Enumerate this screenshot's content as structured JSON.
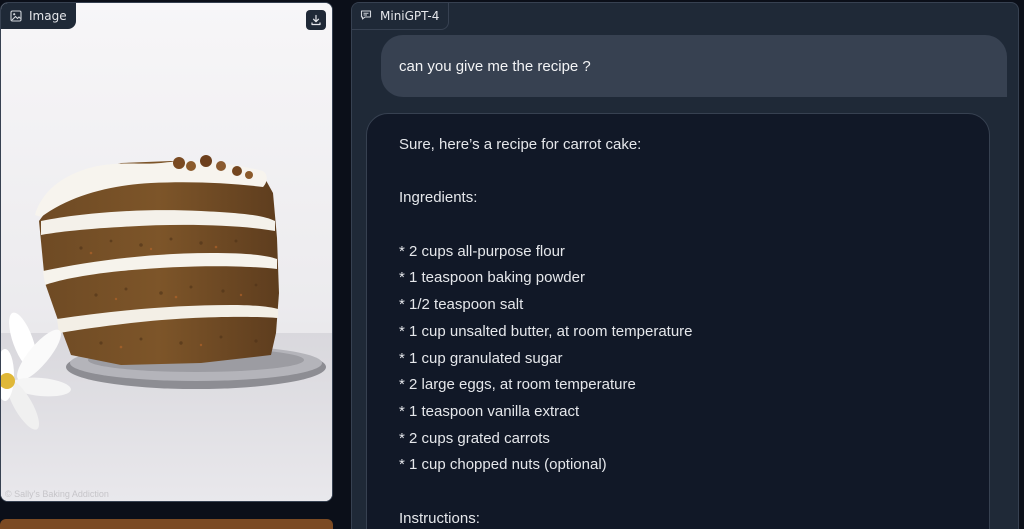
{
  "image_panel": {
    "label": "Image",
    "icon": "image-icon",
    "download_icon": "download-icon",
    "watermark": "© Sally's Baking Addiction"
  },
  "chat_panel": {
    "label": "MiniGPT-4",
    "icon": "chat-icon",
    "user_message": "can you give me the recipe ?",
    "bot_intro": "Sure, here’s a recipe for carrot cake:",
    "ingredients_heading": "Ingredients:",
    "ingredients": [
      "* 2 cups all-purpose flour",
      "* 1 teaspoon baking powder",
      "* 1/2 teaspoon salt",
      "* 1 cup unsalted butter, at room temperature",
      "* 1 cup granulated sugar",
      "* 2 large eggs, at room temperature",
      "* 1 teaspoon vanilla extract",
      "* 2 cups grated carrots",
      "* 1 cup chopped nuts (optional)"
    ],
    "instructions_heading": "Instructions:"
  },
  "colors": {
    "background": "#0b0f19",
    "panel": "#1f2937",
    "user_bubble": "#374151",
    "bot_bubble": "#111827",
    "text": "#e5e7eb"
  }
}
